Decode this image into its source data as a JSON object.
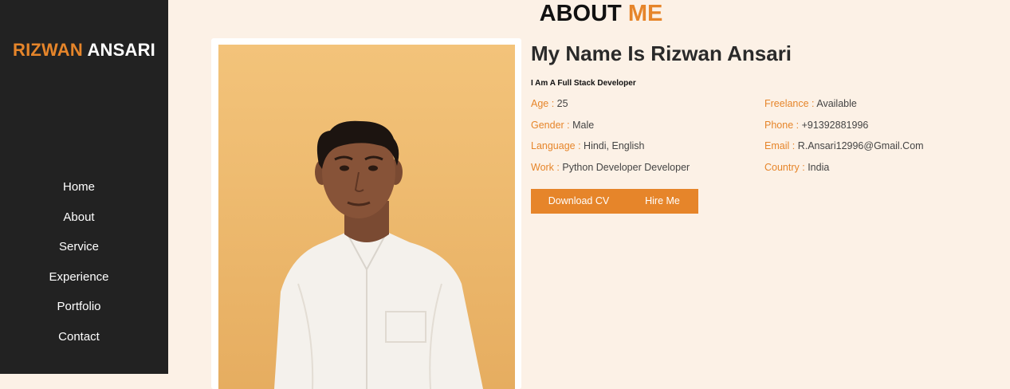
{
  "brand": {
    "first": "RIZWAN",
    "last": "ANSARI"
  },
  "nav": [
    "Home",
    "About",
    "Service",
    "Experience",
    "Portfolio",
    "Contact"
  ],
  "section_title": {
    "main": "ABOUT",
    "accent": "ME"
  },
  "about": {
    "heading": "My Name Is Rizwan Ansari",
    "subtitle": "I Am A Full Stack Developer",
    "facts_left": [
      {
        "label": "Age :",
        "value": "25"
      },
      {
        "label": "Gender :",
        "value": "Male"
      },
      {
        "label": "Language :",
        "value": "Hindi, English"
      },
      {
        "label": "Work :",
        "value": "Python Developer Developer"
      }
    ],
    "facts_right": [
      {
        "label": "Freelance :",
        "value": "Available"
      },
      {
        "label": "Phone :",
        "value": "+91392881996"
      },
      {
        "label": "Email :",
        "value": "R.Ansari12996@Gmail.Com"
      },
      {
        "label": "Country :",
        "value": "India"
      }
    ],
    "buttons": {
      "download": "Download CV",
      "hire": "Hire Me"
    }
  },
  "colors": {
    "accent": "#e6852a",
    "sidebar": "#222222",
    "page_background": "#fcf1e6",
    "photo_background": "#f0bd72"
  },
  "profile_photo": {
    "icon": "person-photo"
  }
}
